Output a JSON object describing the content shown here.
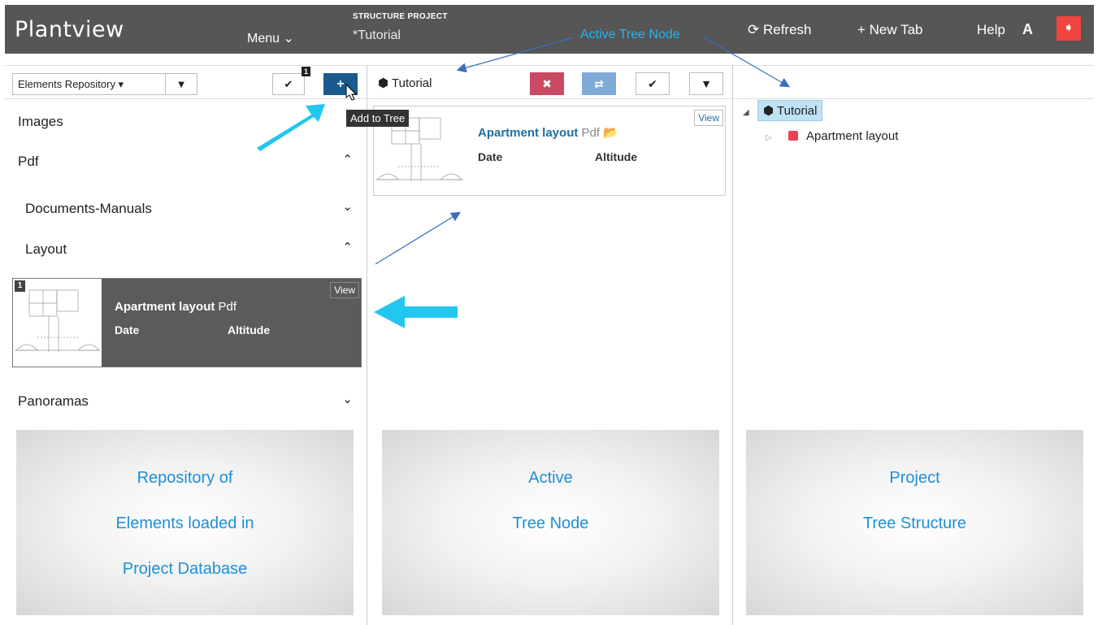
{
  "topbar": {
    "brand": "Plantview",
    "menu": "Menu ⌄",
    "project_kicker": "STRUCTURE PROJECT",
    "project_name": "*Tutorial",
    "annotation": "Active Tree Node",
    "refresh": "⟳ Refresh",
    "new_tab": "+ New Tab",
    "help": "Help",
    "account": "A",
    "logout_icon": "➧"
  },
  "repository": {
    "select_label": "Elements Repository ▾",
    "filter_icon": "▼",
    "check_icon": "✔",
    "badge": "1",
    "add_icon": "+",
    "tooltip": "Add to Tree",
    "sections": [
      {
        "title": "Images",
        "chevron": "⌄"
      },
      {
        "title": "Pdf",
        "chevron": "⌃"
      },
      {
        "title": "Documents-Manuals",
        "chevron": "⌄"
      },
      {
        "title": "Layout",
        "chevron": "⌃"
      },
      {
        "title": "Panoramas",
        "chevron": "⌄"
      }
    ],
    "card": {
      "number": "1",
      "title": "Apartment layout",
      "type": "Pdf",
      "date_label": "Date",
      "altitude_label": "Altitude",
      "view": "View"
    },
    "panel": [
      "Repository of",
      "Elements loaded in",
      "Project Database"
    ]
  },
  "active_node": {
    "title": "Tutorial",
    "delete_icon": "✖",
    "swap_icon": "⇄",
    "check_icon": "✔",
    "filter_icon": "▼",
    "card": {
      "title": "Apartment layout",
      "type": "Pdf",
      "folder_icon": "📂",
      "date_label": "Date",
      "altitude_label": "Altitude",
      "view": "View"
    },
    "panel": [
      "Active",
      "Tree Node"
    ]
  },
  "tree": {
    "root": "Tutorial",
    "child": "Apartment layout",
    "panel": [
      "Project",
      "Tree Structure"
    ]
  },
  "colors": {
    "topbar": "#565656",
    "accent_blue": "#1a5a8e",
    "annotation": "#27b3ee",
    "logout": "#f0453f",
    "delete": "#c94a63",
    "swap": "#7fa9d6",
    "tree_item": "#ef4055"
  }
}
